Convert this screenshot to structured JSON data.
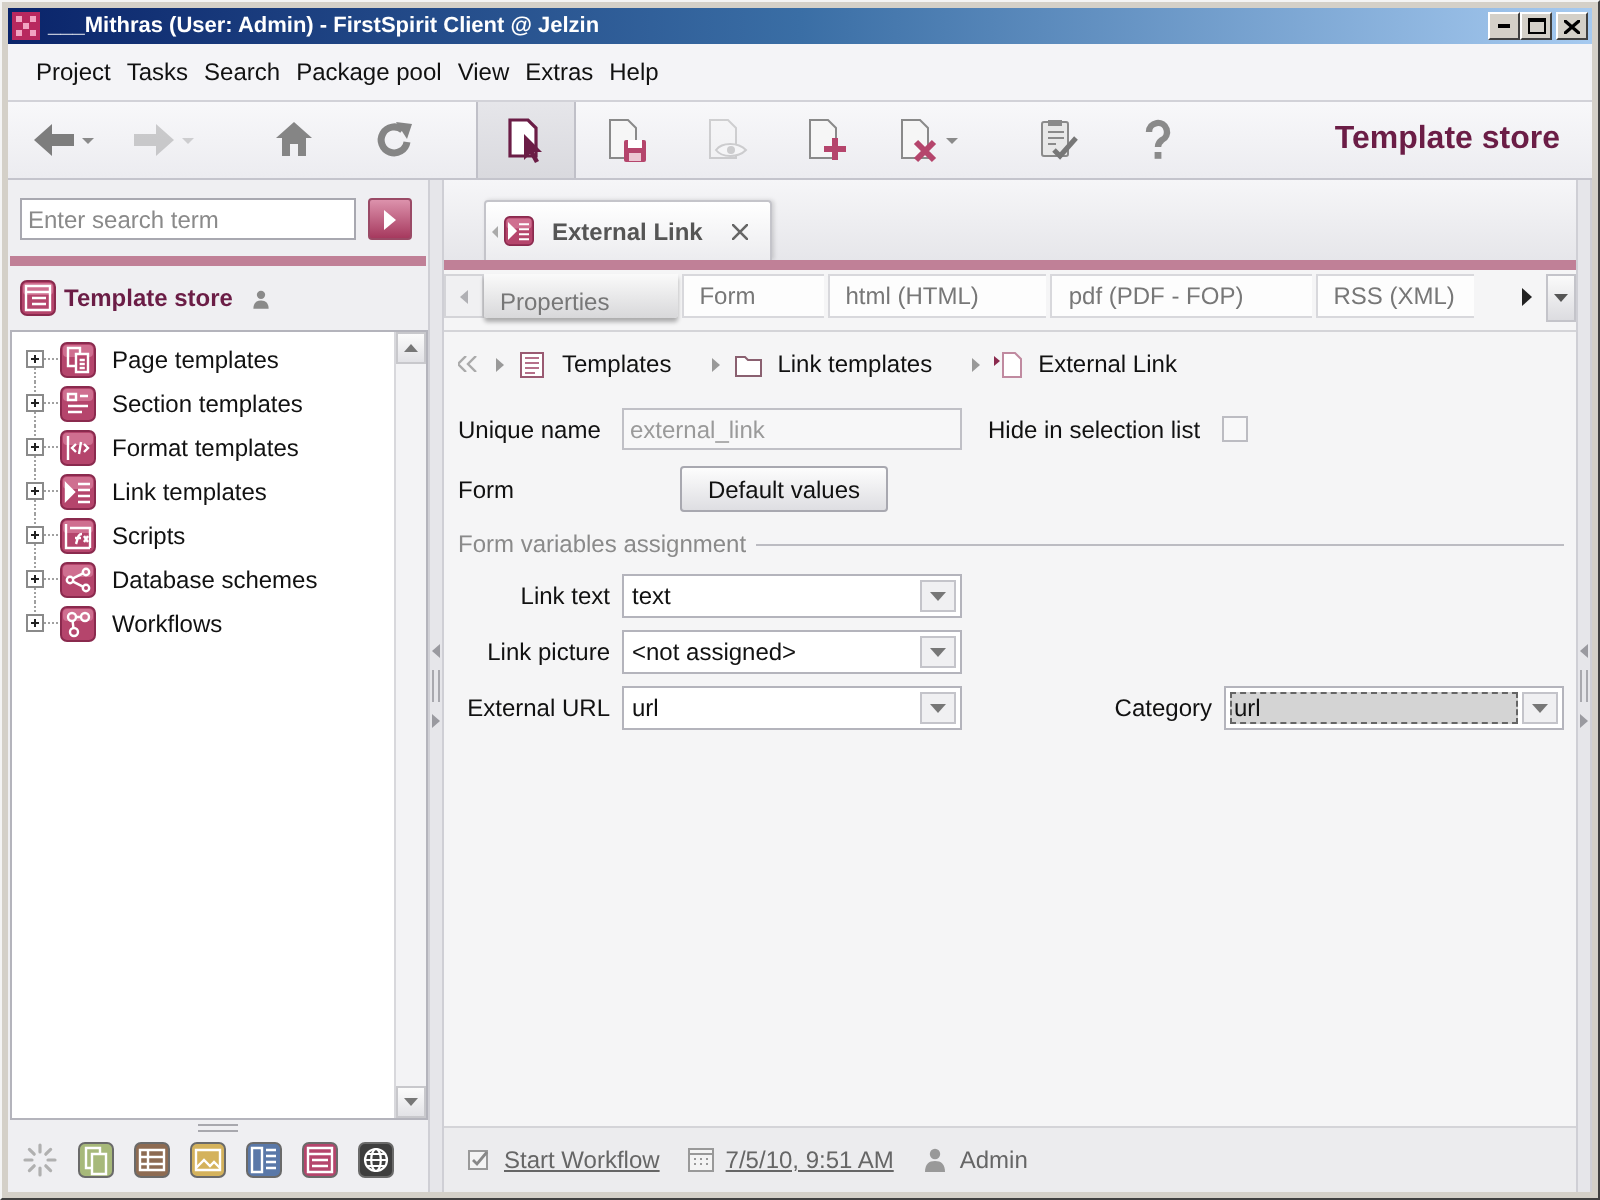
{
  "window": {
    "title": "___Mithras (User: Admin) - FirstSpirit Client @ Jelzin"
  },
  "menu": [
    "Project",
    "Tasks",
    "Search",
    "Package pool",
    "View",
    "Extras",
    "Help"
  ],
  "toolbar": {
    "groups": [
      {
        "buttons": [
          {
            "kind": "back",
            "menu": true,
            "disabled": false,
            "selected": false
          },
          {
            "kind": "forward",
            "menu": true,
            "disabled": true,
            "selected": false
          }
        ]
      },
      {
        "buttons": [
          {
            "kind": "home",
            "menu": false,
            "disabled": false,
            "selected": false
          },
          {
            "kind": "refresh",
            "menu": false,
            "disabled": false,
            "selected": false
          }
        ]
      },
      {
        "buttons": [
          {
            "kind": "template_store",
            "menu": false,
            "disabled": false,
            "selected": true
          },
          {
            "kind": "save",
            "menu": false,
            "disabled": false,
            "selected": false
          },
          {
            "kind": "preview",
            "menu": false,
            "disabled": true,
            "selected": false
          },
          {
            "kind": "new",
            "menu": false,
            "disabled": false,
            "selected": false
          },
          {
            "kind": "delete",
            "menu": true,
            "disabled": false,
            "selected": false
          }
        ]
      },
      {
        "buttons": [
          {
            "kind": "tasks",
            "menu": false,
            "disabled": false,
            "selected": false
          },
          {
            "kind": "help",
            "menu": false,
            "disabled": false,
            "selected": false
          }
        ]
      }
    ],
    "title": "Template store"
  },
  "sidebar": {
    "search": {
      "placeholder": "Enter search term"
    },
    "store": {
      "title": "Template store"
    },
    "tree": [
      {
        "label": "Page templates",
        "kind": "page",
        "expanded": false
      },
      {
        "label": "Section templates",
        "kind": "section",
        "expanded": false
      },
      {
        "label": "Format templates",
        "kind": "format",
        "expanded": false
      },
      {
        "label": "Link templates",
        "kind": "link",
        "expanded": false
      },
      {
        "label": "Scripts",
        "kind": "scripts",
        "expanded": false
      },
      {
        "label": "Database schemes",
        "kind": "database",
        "expanded": false
      },
      {
        "label": "Workflows",
        "kind": "workflow",
        "expanded": false
      }
    ]
  },
  "editor": {
    "tabs": [
      {
        "label": "External Link",
        "selected": true
      }
    ],
    "subtabs": [
      {
        "label": "Properties",
        "selected": true
      },
      {
        "label": "Form",
        "selected": false
      },
      {
        "label": "html (HTML)",
        "selected": false
      },
      {
        "label": "pdf (PDF - FOP)",
        "selected": false
      },
      {
        "label": "RSS (XML)",
        "selected": false
      }
    ],
    "breadcrumb": [
      {
        "label": "Templates",
        "kind": "store"
      },
      {
        "label": "Link templates",
        "kind": "folder"
      },
      {
        "label": "External Link",
        "kind": "link"
      }
    ],
    "fields": {
      "unique_name": {
        "label": "Unique name",
        "value": "external_link",
        "disabled": true
      },
      "hide_in_selection_list": {
        "label": "Hide in selection list",
        "checked": false
      },
      "form": {
        "label": "Form",
        "button": "Default values"
      }
    },
    "assignment": {
      "title": "Form variables assignment",
      "rows": [
        {
          "label": "Link text",
          "value": "text",
          "focused": false
        },
        {
          "label": "Link picture",
          "value": "<not assigned>",
          "focused": false
        },
        {
          "label": "External URL",
          "value": "url",
          "focused": false
        }
      ],
      "category": {
        "label": "Category",
        "value": "url",
        "focused": true
      }
    }
  },
  "status_bar": [
    {
      "kind": "workflow",
      "text": "Start Workflow",
      "link": true
    },
    {
      "kind": "date",
      "text": "7/5/10, 9:51 AM",
      "link": true
    },
    {
      "kind": "user",
      "text": "Admin",
      "link": false
    }
  ]
}
